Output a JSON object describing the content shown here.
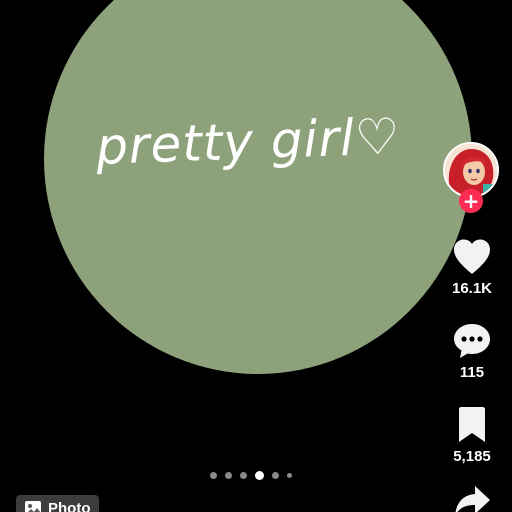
{
  "post": {
    "caption": "pretty girl♡",
    "background_color": "#8da17a"
  },
  "creator": {
    "avatar_icon": "profile-avatar",
    "follow_label": "+"
  },
  "actions": {
    "like_count": "16.1K",
    "comment_count": "115",
    "bookmark_count": "5,185",
    "share_icon": "share-arrow-icon"
  },
  "carousel": {
    "total": 6,
    "active_index": 3
  },
  "media_tag": {
    "label": "Photo"
  },
  "colors": {
    "accent": "#fe2c55",
    "background": "#000000",
    "text": "#ffffff"
  }
}
